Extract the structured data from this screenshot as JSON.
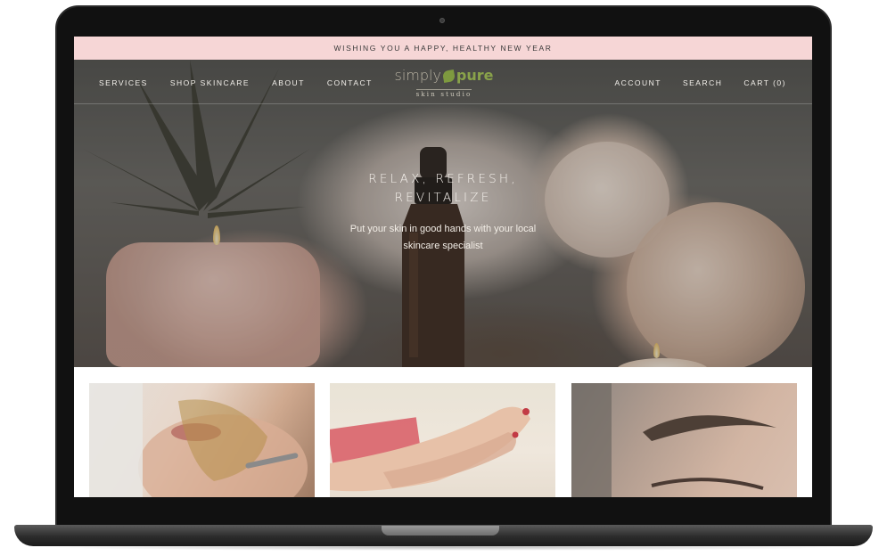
{
  "announcement": "WISHING YOU A HAPPY, HEALTHY NEW YEAR",
  "nav": {
    "left": [
      "SERVICES",
      "SHOP SKINCARE",
      "ABOUT",
      "CONTACT"
    ],
    "right": [
      "ACCOUNT",
      "SEARCH",
      "CART (0)"
    ]
  },
  "logo": {
    "simply": "simply",
    "pure": "pure",
    "subtitle": "skin studio"
  },
  "hero": {
    "heading_line1": "RELAX, REFRESH,",
    "heading_line2": "REVITALIZE",
    "sub_line1": "Put your skin in good hands with your local",
    "sub_line2": "skincare specialist"
  },
  "colors": {
    "announcement_bg": "#f6d6d6",
    "logo_green": "#89a24a",
    "laptop_frame": "#111111"
  }
}
